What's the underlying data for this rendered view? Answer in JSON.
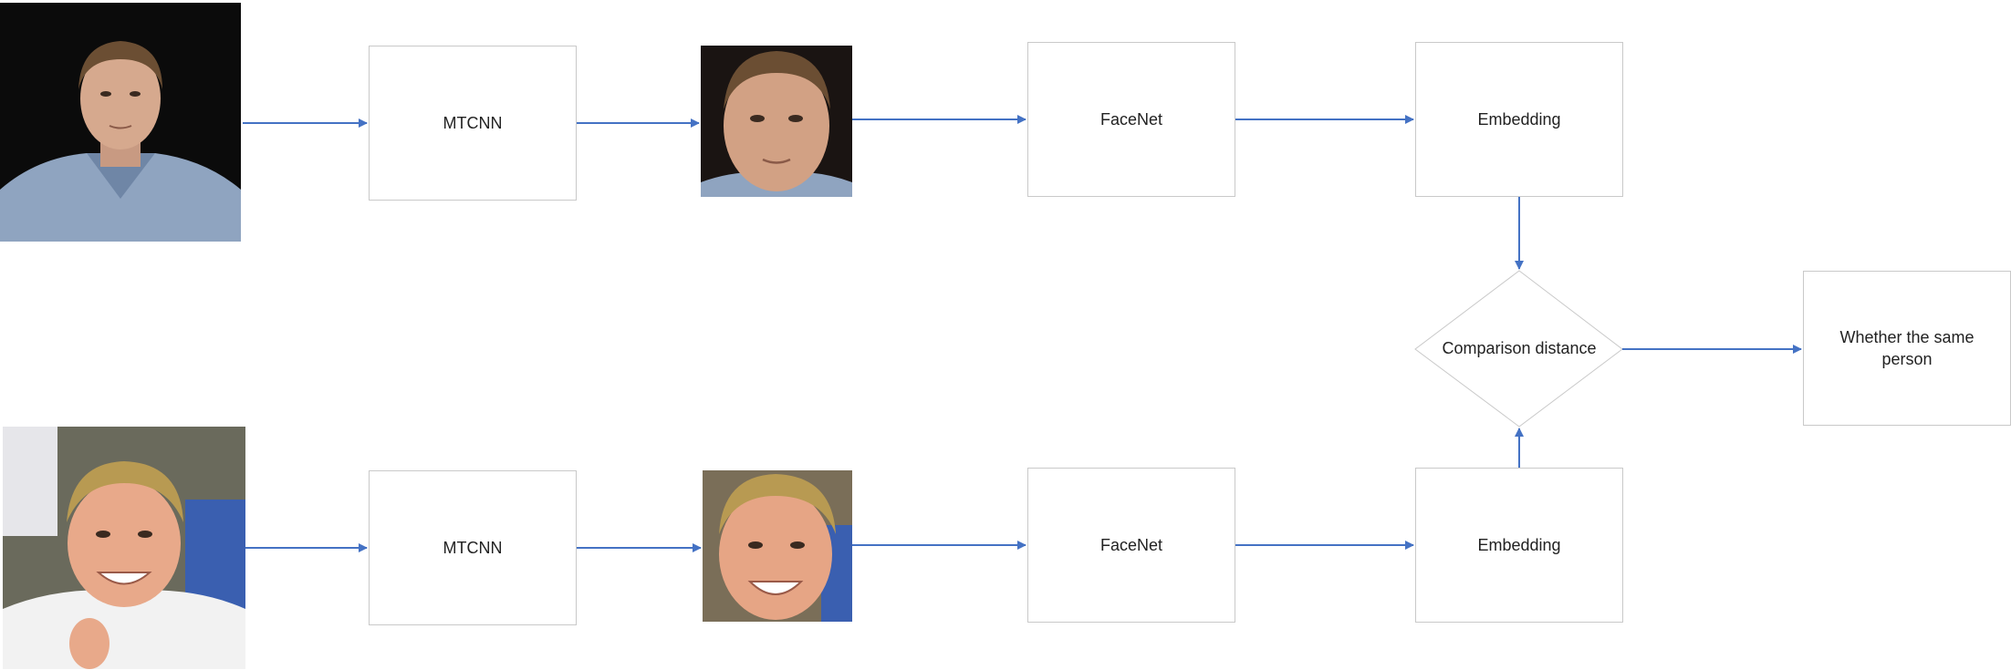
{
  "nodes": {
    "mtcnn_top": "MTCNN",
    "facenet_top": "FaceNet",
    "embedding_top": "Embedding",
    "mtcnn_bottom": "MTCNN",
    "facenet_bottom": "FaceNet",
    "embedding_bottom": "Embedding",
    "comparison": "Comparison distance",
    "result": "Whether the same person"
  },
  "colors": {
    "arrow": "#4472c4",
    "box_border": "#c9c9c9"
  },
  "photos": {
    "top_input": "portrait of a man in blue shirt on black background",
    "top_face": "cropped face of the same man",
    "bottom_input": "smiling blond man in white shirt",
    "bottom_face": "cropped face of the blond man"
  }
}
